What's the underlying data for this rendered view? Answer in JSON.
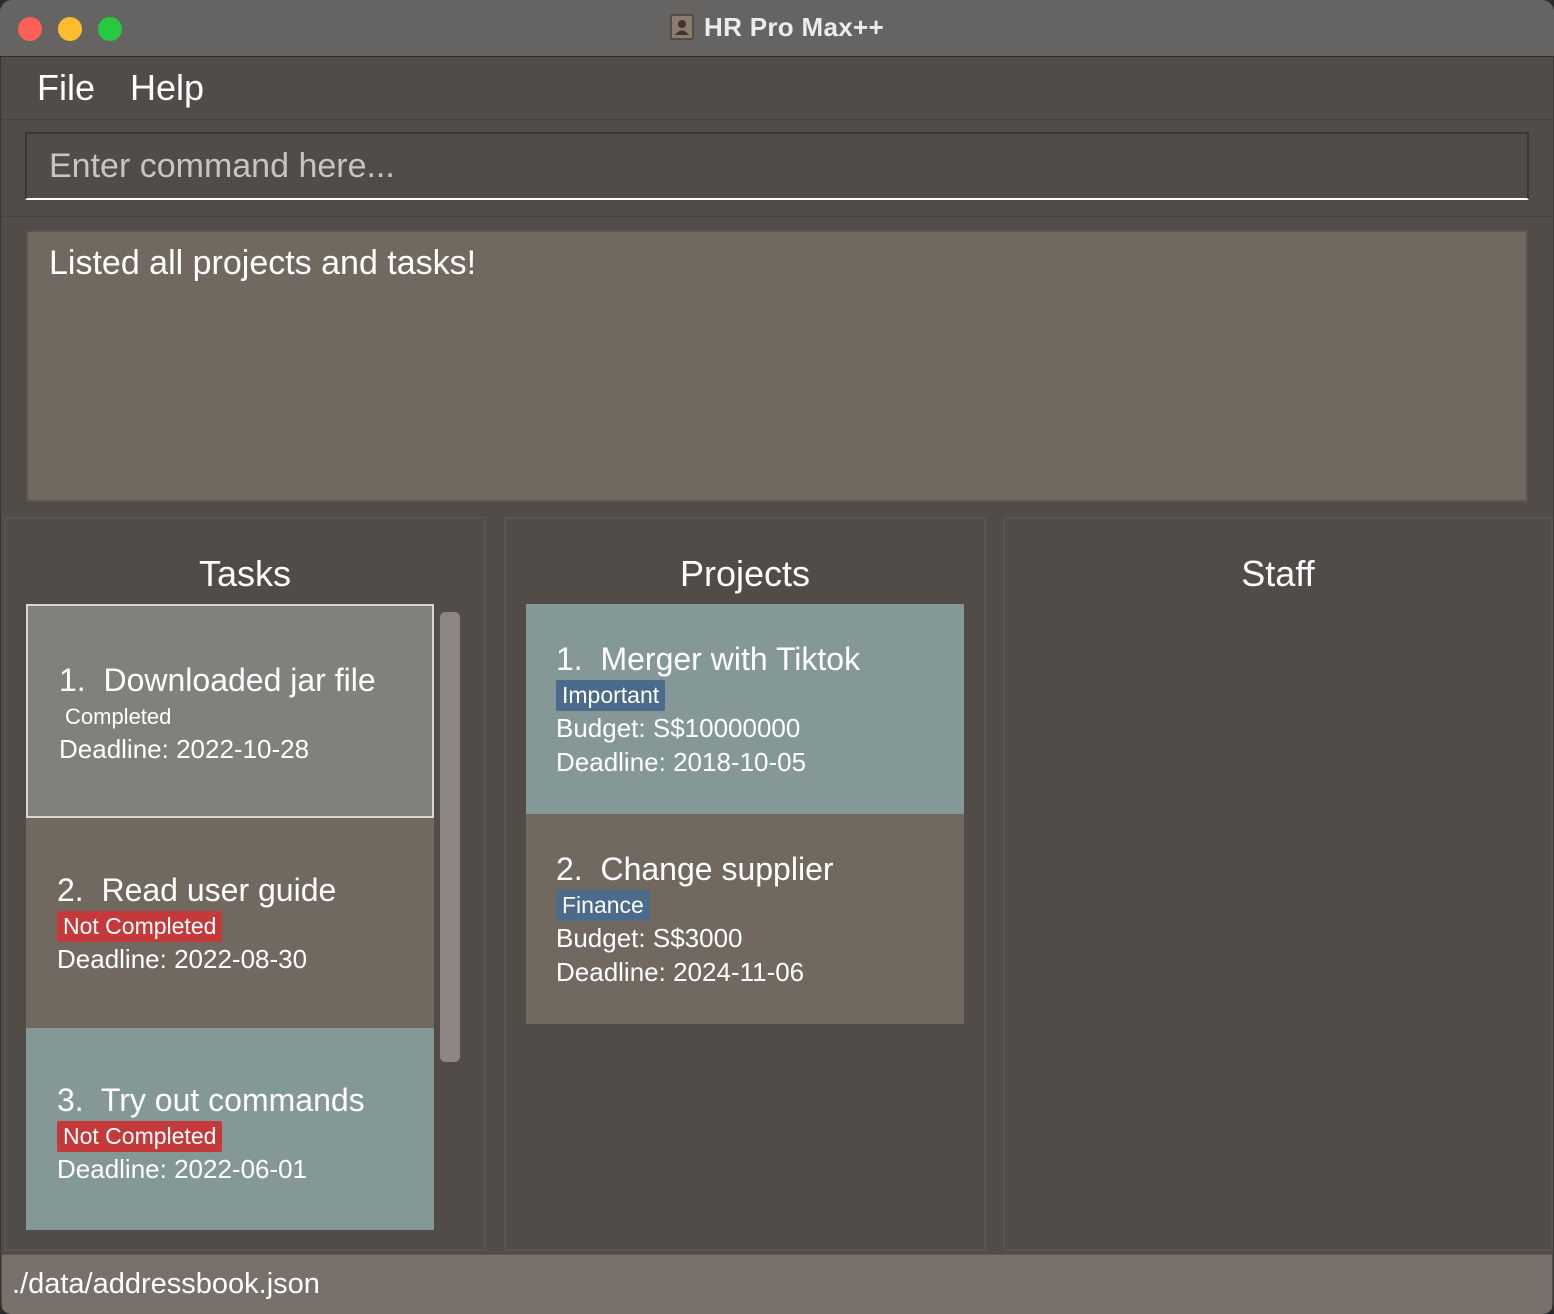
{
  "window": {
    "title": "HR Pro Max++"
  },
  "menu": {
    "file": "File",
    "help": "Help"
  },
  "command": {
    "placeholder": "Enter command here...",
    "value": ""
  },
  "result": {
    "message": "Listed all projects and tasks!"
  },
  "tasks": {
    "title": "Tasks",
    "items": [
      {
        "index": "1.",
        "name": "Downloaded jar file",
        "status": "Completed",
        "deadline": "Deadline: 2022-10-28"
      },
      {
        "index": "2.",
        "name": "Read user guide",
        "status": "Not Completed",
        "deadline": "Deadline: 2022-08-30"
      },
      {
        "index": "3.",
        "name": "Try out commands",
        "status": "Not Completed",
        "deadline": "Deadline: 2022-06-01"
      }
    ]
  },
  "projects": {
    "title": "Projects",
    "items": [
      {
        "index": "1.",
        "name": "Merger with Tiktok",
        "tag": "Important",
        "budget": "Budget: S$10000000",
        "deadline": "Deadline: 2018-10-05"
      },
      {
        "index": "2.",
        "name": "Change supplier",
        "tag": "Finance",
        "budget": "Budget: S$3000",
        "deadline": "Deadline: 2024-11-06"
      }
    ]
  },
  "staff": {
    "title": "Staff"
  },
  "status": {
    "path": "./data/addressbook.json"
  },
  "colors": {
    "background": "#514c48",
    "card_gray": "#7f817a",
    "card_brown": "#71685f",
    "card_teal": "#859898",
    "badge_red": "#c43a3a",
    "badge_blue": "#4c6b8a",
    "status_bar": "#78716b"
  }
}
